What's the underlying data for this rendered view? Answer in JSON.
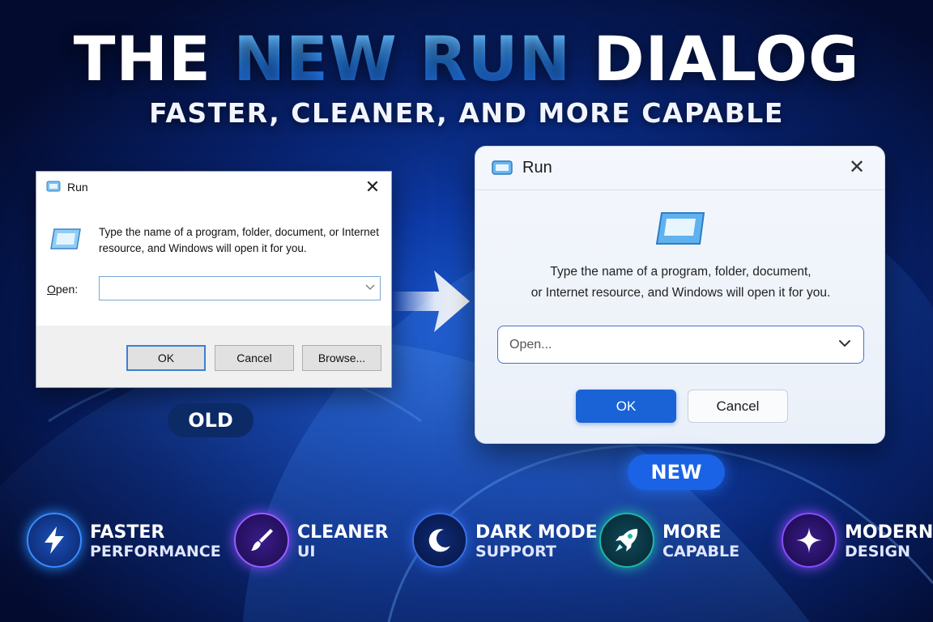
{
  "headline": {
    "part1": "THE ",
    "accent": "NEW RUN",
    "part2": " DIALOG"
  },
  "subheadline": "FASTER, CLEANER, AND MORE CAPABLE",
  "old_dialog": {
    "title": "Run",
    "close_glyph": "✕",
    "description": "Type the name of a program, folder, document, or Internet resource, and Windows will open it for you.",
    "open_label_prefix": "O",
    "open_label_rest": "pen:",
    "open_value": "",
    "buttons": {
      "ok": "OK",
      "cancel": "Cancel",
      "browse": "Browse..."
    },
    "label": "OLD"
  },
  "new_dialog": {
    "title": "Run",
    "close_glyph": "✕",
    "description_line1": "Type the name of a program, folder, document,",
    "description_line2": "or Internet resource, and Windows will open it for you.",
    "open_placeholder": "Open...",
    "buttons": {
      "ok": "OK",
      "cancel": "Cancel"
    },
    "label": "NEW"
  },
  "features": [
    {
      "line1": "FASTER",
      "line2": "PERFORMANCE",
      "icon": "lightning-icon",
      "color": "#2a8cff"
    },
    {
      "line1": "CLEANER",
      "line2": "UI",
      "icon": "brush-icon",
      "color": "#9a5cff"
    },
    {
      "line1": "DARK MODE",
      "line2": "SUPPORT",
      "icon": "moon-icon",
      "color": "#2f66e0"
    },
    {
      "line1": "MORE",
      "line2": "CAPABLE",
      "icon": "rocket-icon",
      "color": "#1fb7a8"
    },
    {
      "line1": "MODERN",
      "line2": "DESIGN",
      "icon": "sparkle-icon",
      "color": "#8a4cff"
    }
  ]
}
